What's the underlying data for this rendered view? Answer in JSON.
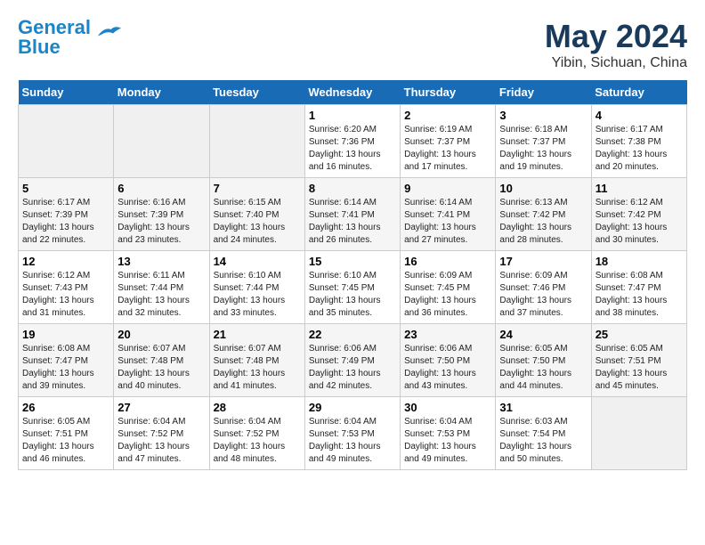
{
  "header": {
    "logo_general": "General",
    "logo_blue": "Blue",
    "month_year": "May 2024",
    "location": "Yibin, Sichuan, China"
  },
  "weekdays": [
    "Sunday",
    "Monday",
    "Tuesday",
    "Wednesday",
    "Thursday",
    "Friday",
    "Saturday"
  ],
  "weeks": [
    [
      {
        "day": "",
        "info": ""
      },
      {
        "day": "",
        "info": ""
      },
      {
        "day": "",
        "info": ""
      },
      {
        "day": "1",
        "info": "Sunrise: 6:20 AM\nSunset: 7:36 PM\nDaylight: 13 hours\nand 16 minutes."
      },
      {
        "day": "2",
        "info": "Sunrise: 6:19 AM\nSunset: 7:37 PM\nDaylight: 13 hours\nand 17 minutes."
      },
      {
        "day": "3",
        "info": "Sunrise: 6:18 AM\nSunset: 7:37 PM\nDaylight: 13 hours\nand 19 minutes."
      },
      {
        "day": "4",
        "info": "Sunrise: 6:17 AM\nSunset: 7:38 PM\nDaylight: 13 hours\nand 20 minutes."
      }
    ],
    [
      {
        "day": "5",
        "info": "Sunrise: 6:17 AM\nSunset: 7:39 PM\nDaylight: 13 hours\nand 22 minutes."
      },
      {
        "day": "6",
        "info": "Sunrise: 6:16 AM\nSunset: 7:39 PM\nDaylight: 13 hours\nand 23 minutes."
      },
      {
        "day": "7",
        "info": "Sunrise: 6:15 AM\nSunset: 7:40 PM\nDaylight: 13 hours\nand 24 minutes."
      },
      {
        "day": "8",
        "info": "Sunrise: 6:14 AM\nSunset: 7:41 PM\nDaylight: 13 hours\nand 26 minutes."
      },
      {
        "day": "9",
        "info": "Sunrise: 6:14 AM\nSunset: 7:41 PM\nDaylight: 13 hours\nand 27 minutes."
      },
      {
        "day": "10",
        "info": "Sunrise: 6:13 AM\nSunset: 7:42 PM\nDaylight: 13 hours\nand 28 minutes."
      },
      {
        "day": "11",
        "info": "Sunrise: 6:12 AM\nSunset: 7:42 PM\nDaylight: 13 hours\nand 30 minutes."
      }
    ],
    [
      {
        "day": "12",
        "info": "Sunrise: 6:12 AM\nSunset: 7:43 PM\nDaylight: 13 hours\nand 31 minutes."
      },
      {
        "day": "13",
        "info": "Sunrise: 6:11 AM\nSunset: 7:44 PM\nDaylight: 13 hours\nand 32 minutes."
      },
      {
        "day": "14",
        "info": "Sunrise: 6:10 AM\nSunset: 7:44 PM\nDaylight: 13 hours\nand 33 minutes."
      },
      {
        "day": "15",
        "info": "Sunrise: 6:10 AM\nSunset: 7:45 PM\nDaylight: 13 hours\nand 35 minutes."
      },
      {
        "day": "16",
        "info": "Sunrise: 6:09 AM\nSunset: 7:45 PM\nDaylight: 13 hours\nand 36 minutes."
      },
      {
        "day": "17",
        "info": "Sunrise: 6:09 AM\nSunset: 7:46 PM\nDaylight: 13 hours\nand 37 minutes."
      },
      {
        "day": "18",
        "info": "Sunrise: 6:08 AM\nSunset: 7:47 PM\nDaylight: 13 hours\nand 38 minutes."
      }
    ],
    [
      {
        "day": "19",
        "info": "Sunrise: 6:08 AM\nSunset: 7:47 PM\nDaylight: 13 hours\nand 39 minutes."
      },
      {
        "day": "20",
        "info": "Sunrise: 6:07 AM\nSunset: 7:48 PM\nDaylight: 13 hours\nand 40 minutes."
      },
      {
        "day": "21",
        "info": "Sunrise: 6:07 AM\nSunset: 7:48 PM\nDaylight: 13 hours\nand 41 minutes."
      },
      {
        "day": "22",
        "info": "Sunrise: 6:06 AM\nSunset: 7:49 PM\nDaylight: 13 hours\nand 42 minutes."
      },
      {
        "day": "23",
        "info": "Sunrise: 6:06 AM\nSunset: 7:50 PM\nDaylight: 13 hours\nand 43 minutes."
      },
      {
        "day": "24",
        "info": "Sunrise: 6:05 AM\nSunset: 7:50 PM\nDaylight: 13 hours\nand 44 minutes."
      },
      {
        "day": "25",
        "info": "Sunrise: 6:05 AM\nSunset: 7:51 PM\nDaylight: 13 hours\nand 45 minutes."
      }
    ],
    [
      {
        "day": "26",
        "info": "Sunrise: 6:05 AM\nSunset: 7:51 PM\nDaylight: 13 hours\nand 46 minutes."
      },
      {
        "day": "27",
        "info": "Sunrise: 6:04 AM\nSunset: 7:52 PM\nDaylight: 13 hours\nand 47 minutes."
      },
      {
        "day": "28",
        "info": "Sunrise: 6:04 AM\nSunset: 7:52 PM\nDaylight: 13 hours\nand 48 minutes."
      },
      {
        "day": "29",
        "info": "Sunrise: 6:04 AM\nSunset: 7:53 PM\nDaylight: 13 hours\nand 49 minutes."
      },
      {
        "day": "30",
        "info": "Sunrise: 6:04 AM\nSunset: 7:53 PM\nDaylight: 13 hours\nand 49 minutes."
      },
      {
        "day": "31",
        "info": "Sunrise: 6:03 AM\nSunset: 7:54 PM\nDaylight: 13 hours\nand 50 minutes."
      },
      {
        "day": "",
        "info": ""
      }
    ]
  ]
}
